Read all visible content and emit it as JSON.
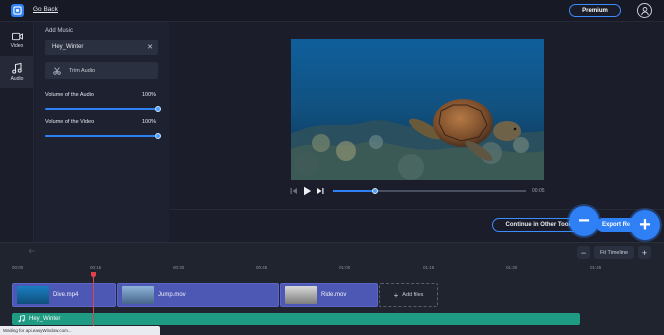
{
  "header": {
    "logo_text": "",
    "go_back": "Go Back",
    "premium": "Premium"
  },
  "rail": {
    "items": [
      {
        "label": "Video",
        "icon": "video-camera-icon"
      },
      {
        "label": "Audio",
        "icon": "music-note-icon"
      }
    ]
  },
  "panel": {
    "title": "Add Music",
    "track_name": "Hey_Winter",
    "trim_label": "Trim Audio",
    "audio_volume_label": "Volume of the Audio",
    "audio_volume_value": "100%",
    "video_volume_label": "Volume of the Video",
    "video_volume_value": "100%"
  },
  "player": {
    "timecode": "00:05",
    "progress": 0.22
  },
  "actions": {
    "continue": "Continue in Other Tools",
    "export": "Export Re"
  },
  "timeline": {
    "undo": "Undo",
    "fit": "Fit Timeline",
    "ticks": [
      "00:00",
      "00:15",
      "00:30",
      "00:45",
      "01:00",
      "01:15",
      "01:30",
      "01:45"
    ],
    "clips": [
      {
        "name": "Dive.mp4"
      },
      {
        "name": "Jump.mov"
      },
      {
        "name": "Ride.mov"
      }
    ],
    "add_files": "Add files",
    "audio_track": "Hey_Winter"
  },
  "status_bar": "Waiting for api.easyWindow.com...",
  "colors": {
    "accent": "#2f7ff5",
    "audio_track": "#1f9a83",
    "clip": "#4d58b5",
    "playhead": "#e0414c"
  }
}
